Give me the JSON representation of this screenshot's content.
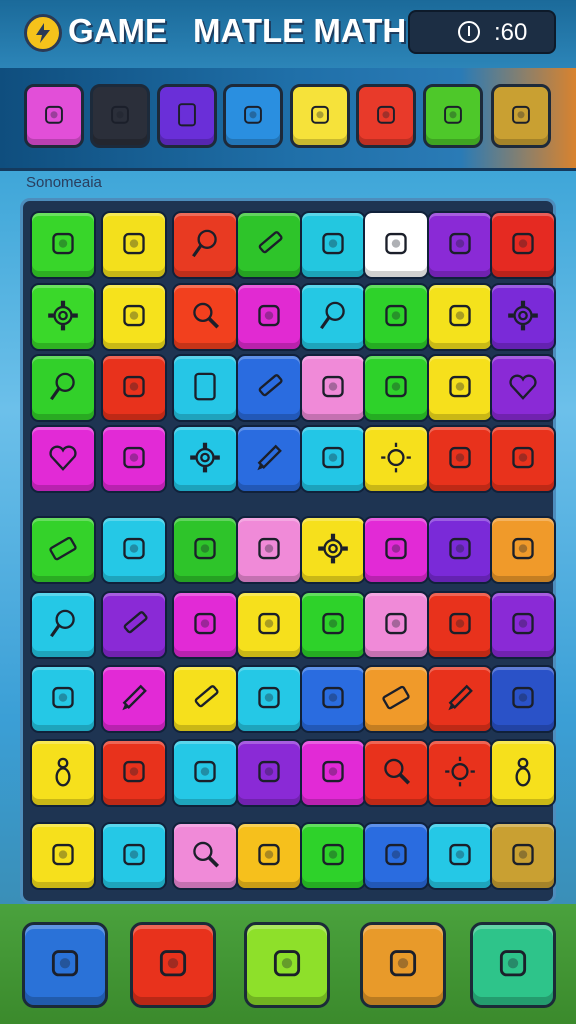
{
  "header": {
    "title_word1": "GAME",
    "title_word2": "MATLE MATHI",
    "timer_text": ":60",
    "logo_icon": "lightning-coin-icon",
    "timer_icon": "info-icon"
  },
  "section_label": "Sonomeaia",
  "topbar": {
    "tiles": [
      {
        "icon": "radio-icon",
        "color": "#e24fd8"
      },
      {
        "icon": "camera-icon",
        "color": "#2b2f3a"
      },
      {
        "icon": "tablet-icon",
        "color": "#6a2fd8"
      },
      {
        "icon": "compass-icon",
        "color": "#2a8fe0"
      },
      {
        "icon": "laptop-icon",
        "color": "#f6e23a"
      },
      {
        "icon": "heart-pen-icon",
        "color": "#e83a2a"
      },
      {
        "icon": "jar-icon",
        "color": "#4ec82a"
      },
      {
        "icon": "map-icon",
        "color": "#c9a032"
      }
    ]
  },
  "board": {
    "rows": [
      [
        {
          "icon": "broom-icon",
          "color": "#38d62a"
        },
        {
          "icon": "briefcase-icon",
          "color": "#f3e01c"
        },
        {
          "icon": "lollipop-icon",
          "color": "#e83a22"
        },
        {
          "icon": "crayon-icon",
          "color": "#2ec42a"
        },
        {
          "icon": "flower-icon",
          "color": "#23c7e0"
        },
        {
          "icon": "maple-leaf-icon",
          "color": "#ffffff"
        },
        {
          "icon": "cherries-icon",
          "color": "#8a2ad6"
        },
        {
          "icon": "tooth-icon",
          "color": "#e52a22"
        }
      ],
      [
        {
          "icon": "gear-icon",
          "color": "#3ad82a"
        },
        {
          "icon": "shoe-icon",
          "color": "#f6e21c"
        },
        {
          "icon": "magnifier-icon",
          "color": "#f2401e"
        },
        {
          "icon": "glove-icon",
          "color": "#e12ad2"
        },
        {
          "icon": "lollipop-icon",
          "color": "#25c8e4"
        },
        {
          "icon": "paper-roll-icon",
          "color": "#2ed22a"
        },
        {
          "icon": "sewing-machine-icon",
          "color": "#f4e21c"
        },
        {
          "icon": "gear-icon",
          "color": "#7a2ad8"
        }
      ],
      [
        {
          "icon": "lollipop-icon",
          "color": "#32d02a"
        },
        {
          "icon": "bandage-icon",
          "color": "#e8321c"
        },
        {
          "icon": "tablet-icon",
          "color": "#26c6e6"
        },
        {
          "icon": "crayon-icon",
          "color": "#2a6ce0"
        },
        {
          "icon": "notebook-icon",
          "color": "#f08ad8"
        },
        {
          "icon": "joystick-icon",
          "color": "#2ed22a"
        },
        {
          "icon": "frying-pan-icon",
          "color": "#f6e01c"
        },
        {
          "icon": "heart-bubble-icon",
          "color": "#8a2ad6"
        }
      ],
      [
        {
          "icon": "heart-badge-icon",
          "color": "#e22ad6"
        },
        {
          "icon": "headphones-icon",
          "color": "#e22ad6"
        },
        {
          "icon": "gear-icon",
          "color": "#23c6e6"
        },
        {
          "icon": "pencil-icon",
          "color": "#2a6ce0"
        },
        {
          "icon": "roll-icon",
          "color": "#23c6e6"
        },
        {
          "icon": "sun-icon",
          "color": "#f6e01c"
        },
        {
          "icon": "hand-icon",
          "color": "#e8321c"
        },
        {
          "icon": "helmet-icon",
          "color": "#e8321c"
        }
      ],
      [
        {
          "icon": "eraser-icon",
          "color": "#34d22a"
        },
        {
          "icon": "leaf-icon",
          "color": "#25c8e6"
        },
        {
          "icon": "drumstick-icon",
          "color": "#2ec42a"
        },
        {
          "icon": "heart-bag-icon",
          "color": "#f08ad8"
        },
        {
          "icon": "gear-icon",
          "color": "#f6e01c"
        },
        {
          "icon": "bucket-icon",
          "color": "#e22ad6"
        },
        {
          "icon": "lock-icon",
          "color": "#7a2ad8"
        },
        {
          "icon": "suitcase-icon",
          "color": "#f09a2a"
        }
      ],
      [
        {
          "icon": "lollipop-icon",
          "color": "#25c8e6"
        },
        {
          "icon": "crayon-icon",
          "color": "#8a2ad6"
        },
        {
          "icon": "film-icon",
          "color": "#e22ad6"
        },
        {
          "icon": "onion-icon",
          "color": "#f6e01c"
        },
        {
          "icon": "cassette-icon",
          "color": "#2ed22a"
        },
        {
          "icon": "envelope-icon",
          "color": "#f08ad8"
        },
        {
          "icon": "box-icon",
          "color": "#e8321c"
        },
        {
          "icon": "ghost-icon",
          "color": "#8a2ad6"
        }
      ],
      [
        {
          "icon": "flame-icon",
          "color": "#25c8e6"
        },
        {
          "icon": "pencil-icon",
          "color": "#e22ad6"
        },
        {
          "icon": "crayon-icon",
          "color": "#f6e01c"
        },
        {
          "icon": "cloud-icon",
          "color": "#25c8e6"
        },
        {
          "icon": "pen-icon",
          "color": "#2a6ce0"
        },
        {
          "icon": "eraser-icon",
          "color": "#f09a2a"
        },
        {
          "icon": "pencil-icon",
          "color": "#e8321c"
        },
        {
          "icon": "blocks-icon",
          "color": "#2a52c8"
        }
      ],
      [
        {
          "icon": "bowling-pin-icon",
          "color": "#f6e01c"
        },
        {
          "icon": "cookie-icon",
          "color": "#e8321c"
        },
        {
          "icon": "frog-icon",
          "color": "#25c8e6"
        },
        {
          "icon": "bicycle-icon",
          "color": "#8a2ad6"
        },
        {
          "icon": "bomb-icon",
          "color": "#e22ad6"
        },
        {
          "icon": "magnifier-icon",
          "color": "#e8321c"
        },
        {
          "icon": "sun-icon",
          "color": "#e8321c"
        },
        {
          "icon": "bowling-pin-icon",
          "color": "#f6e01c"
        }
      ],
      [
        {
          "icon": "document-icon",
          "color": "#f6e01c"
        },
        {
          "icon": "knife-icon",
          "color": "#25c8e6"
        },
        {
          "icon": "magnifier-icon",
          "color": "#f08ad8"
        },
        {
          "icon": "book-icon",
          "color": "#f6c01c"
        },
        {
          "icon": "bowl-icon",
          "color": "#2ed22a"
        },
        {
          "icon": "chopsticks-icon",
          "color": "#2a6ce0"
        },
        {
          "icon": "balloon-icon",
          "color": "#25c8e6"
        },
        {
          "icon": "football-icon",
          "color": "#c9a032"
        }
      ]
    ]
  },
  "bottombar": {
    "buttons": [
      {
        "icon": "bone-icon",
        "color": "#2a72d8"
      },
      {
        "icon": "truck-icon",
        "color": "#e8321c"
      },
      {
        "icon": "tree-icon",
        "color": "#8ee02a"
      },
      {
        "icon": "ticket-icon",
        "color": "#e89a2a"
      },
      {
        "icon": "sticker-icon",
        "color": "#2ec48a"
      }
    ]
  }
}
